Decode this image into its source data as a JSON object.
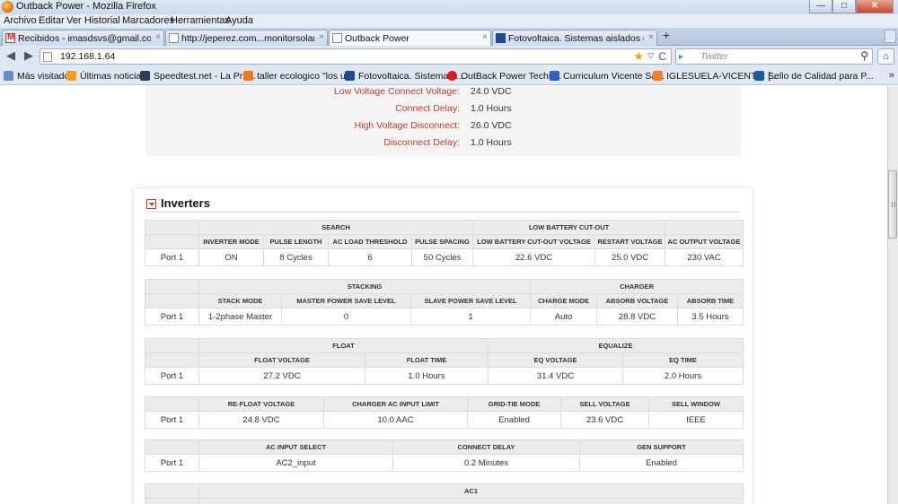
{
  "window": {
    "title": "Outback Power - Mozilla Firefox",
    "controls": {
      "minimize": "—",
      "maximize": "□",
      "close": "✕"
    }
  },
  "menu": [
    "Archivo",
    "Editar",
    "Ver",
    "Historial",
    "Marcadores",
    "Herramientas",
    "Ayuda"
  ],
  "tabs": [
    {
      "label": "Recibidos - imasdsvs@gmail.com - G...",
      "icon": "gmail-icon"
    },
    {
      "label": "http://jeperez.com...monitorsolar.html",
      "icon": "page-icon"
    },
    {
      "label": "Outback Power",
      "icon": "page-icon",
      "active": true
    },
    {
      "label": "Fotovoltaica. Sistemas aislados de la r...",
      "icon": "fotovoltaica-icon"
    }
  ],
  "tab_close": "×",
  "newtab": "+",
  "nav": {
    "back": "◀",
    "forward": "▶",
    "url": "192.168.1.64",
    "search_placeholder": "Twitter",
    "search_engine": "▸",
    "star": "★",
    "dropdown": "▽",
    "reload": "C",
    "search_icon": "⚲",
    "home": "⌂"
  },
  "bookmarks": [
    {
      "label": "Más visitados",
      "color": "#6a8cc4"
    },
    {
      "label": "Últimas noticias",
      "color": "#f0a020"
    },
    {
      "label": "Speedtest.net - La Pru...",
      "color": "#2b3e5a"
    },
    {
      "label": "taller ecologico \"los u...",
      "color": "#f07820"
    },
    {
      "label": "Fotovoltaica. Sistemas ...",
      "color": "#1c4c8c"
    },
    {
      "label": "OutBack Power Techn...",
      "color": "#d02020"
    },
    {
      "label": "Curriculum Vicente Sá...",
      "color": "#2f5fc0"
    },
    {
      "label": "IGLESUELA-VICENTE: [...",
      "color": "#f08020"
    },
    {
      "label": "Sello de Calidad para P...",
      "color": "#1a5aa0"
    }
  ],
  "bookmarks_more": "»",
  "charger_settings": [
    {
      "label": "Low Voltage Connect Voltage:",
      "value": "24.0 VDC"
    },
    {
      "label": "Connect Delay:",
      "value": "1.0 Hours"
    },
    {
      "label": "High Voltage Disconnect:",
      "value": "26.0 VDC"
    },
    {
      "label": "Disconnect Delay:",
      "value": "1.0 Hours"
    }
  ],
  "inverters": {
    "title": "Inverters",
    "port": "Port 1",
    "t1": {
      "groups": [
        "SEARCH",
        "LOW BATTERY CUT-OUT"
      ],
      "headers": [
        "INVERTER MODE",
        "PULSE LENGTH",
        "AC LOAD THRESHOLD",
        "PULSE SPACING",
        "LOW BATTERY CUT-OUT VOLTAGE",
        "RESTART VOLTAGE",
        "AC OUTPUT VOLTAGE"
      ],
      "values": [
        "ON",
        "8 Cycles",
        "6",
        "50 Cycles",
        "22.6 VDC",
        "25.0 VDC",
        "230 VAC"
      ]
    },
    "t2": {
      "groups": [
        "STACKING",
        "CHARGER"
      ],
      "headers": [
        "STACK MODE",
        "MASTER POWER SAVE LEVEL",
        "SLAVE POWER SAVE LEVEL",
        "CHARGE MODE",
        "ABSORB VOLTAGE",
        "ABSORB TIME"
      ],
      "values": [
        "1-2phase Master",
        "0",
        "1",
        "Auto",
        "28.8 VDC",
        "3.5 Hours"
      ]
    },
    "t3": {
      "groups": [
        "FLOAT",
        "EQUALIZE"
      ],
      "headers": [
        "FLOAT VOLTAGE",
        "FLOAT TIME",
        "EQ VOLTAGE",
        "EQ TIME"
      ],
      "values": [
        "27.2 VDC",
        "1.0 Hours",
        "31.4 VDC",
        "2.0 Hours"
      ]
    },
    "t4": {
      "headers": [
        "RE-FLOAT VOLTAGE",
        "CHARGER AC INPUT LIMIT",
        "GRID-TIE MODE",
        "SELL VOLTAGE",
        "SELL WINDOW"
      ],
      "values": [
        "24.8 VDC",
        "10.0 AAC",
        "Enabled",
        "23.6 VDC",
        "IEEE"
      ]
    },
    "t5": {
      "headers": [
        "AC INPUT SELECT",
        "CONNECT DELAY",
        "GEN SUPPORT"
      ],
      "values": [
        "AC2_input",
        "0.2 Minutes",
        "Enabled"
      ]
    },
    "t6": {
      "groups": [
        "AC1"
      ]
    }
  }
}
